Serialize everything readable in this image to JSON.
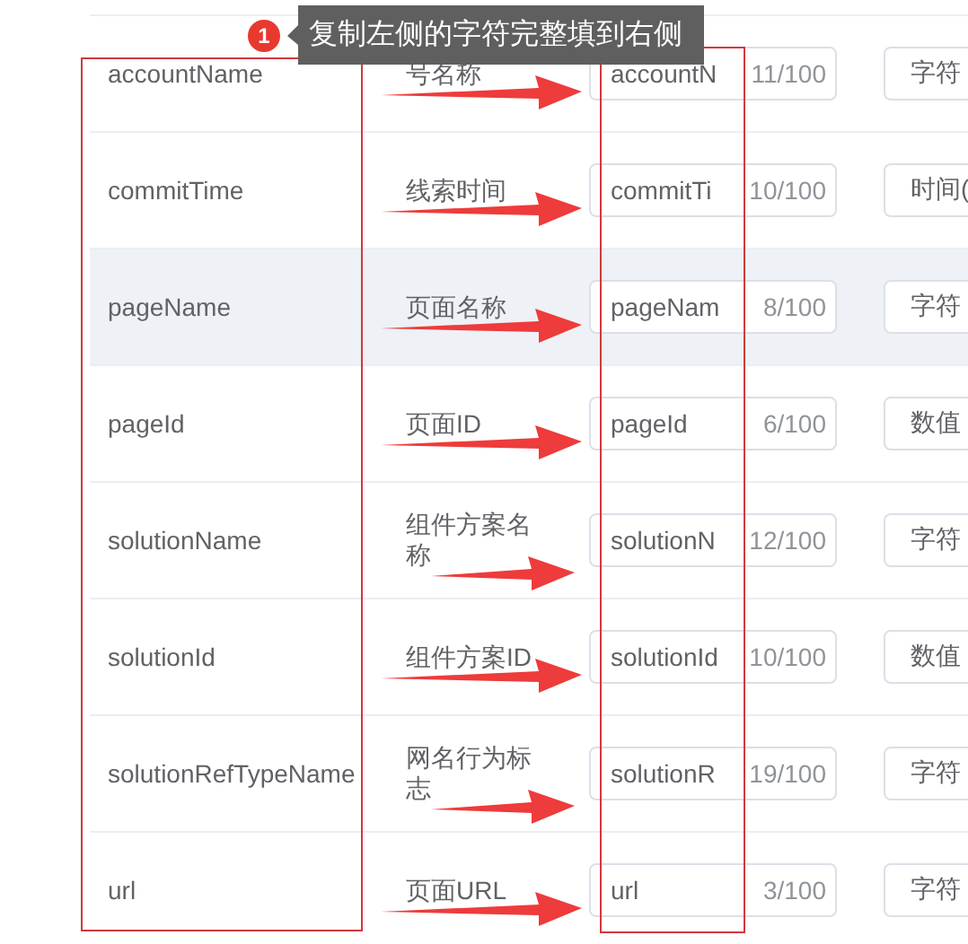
{
  "tooltip": {
    "badge": "1",
    "text": "复制左侧的字符完整填到右侧"
  },
  "rows": [
    {
      "name": "accountName",
      "label": "号名称",
      "value": "accountN",
      "count": "11/100",
      "type": "字符",
      "hovered": false
    },
    {
      "name": "commitTime",
      "label": "线索时间",
      "value": "commitTi",
      "count": "10/100",
      "type": "时间(",
      "hovered": false
    },
    {
      "name": "pageName",
      "label": "页面名称",
      "value": "pageNam",
      "count": "8/100",
      "type": "字符",
      "hovered": true
    },
    {
      "name": "pageId",
      "label": "页面ID",
      "value": "pageId",
      "count": "6/100",
      "type": "数值",
      "hovered": false
    },
    {
      "name": "solutionName",
      "label": "组件方案名称",
      "value": "solutionN",
      "count": "12/100",
      "type": "字符",
      "hovered": false
    },
    {
      "name": "solutionId",
      "label": "组件方案ID",
      "value": "solutionId",
      "count": "10/100",
      "type": "数值",
      "hovered": false
    },
    {
      "name": "solutionRefTypeName",
      "label": "网名行为标志",
      "value": "solutionR",
      "count": "19/100",
      "type": "字符",
      "hovered": false
    },
    {
      "name": "url",
      "label": "页面URL",
      "value": "url",
      "count": "3/100",
      "type": "字符",
      "hovered": false
    }
  ]
}
